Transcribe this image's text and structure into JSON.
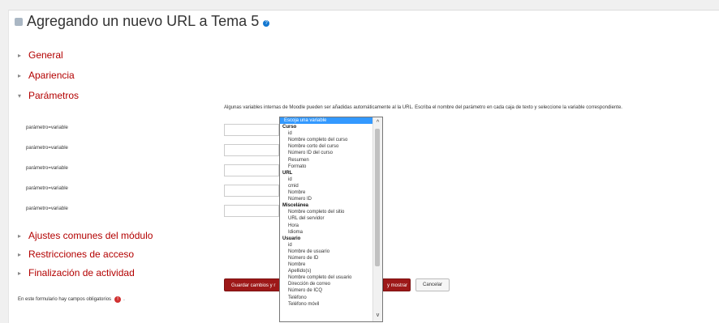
{
  "page": {
    "title": "Agregando un nuevo URL a Tema 5",
    "help_glyph": "?"
  },
  "sections": {
    "general": "General",
    "apariencia": "Apariencia",
    "parametros": "Parámetros",
    "ajustes": "Ajustes comunes del módulo",
    "restricciones": "Restricciones de acceso",
    "finalizacion": "Finalización de actividad"
  },
  "parametros": {
    "intro": "Algunas variables internas de Moodle pueden ser añadidas automáticamente al la URL. Escriba el nombre del parámetro en cada caja de texto y seleccione la variable correspondiente.",
    "rows": [
      {
        "label": "parámetro=variable",
        "value": ""
      },
      {
        "label": "parámetro=variable",
        "value": ""
      },
      {
        "label": "parámetro=variable",
        "value": ""
      },
      {
        "label": "parámetro=variable",
        "value": ""
      },
      {
        "label": "parámetro=variable",
        "value": ""
      }
    ]
  },
  "dropdown": {
    "selected": "Escoja una variable",
    "items": [
      {
        "text": "Escoja una variable",
        "kind": "selected"
      },
      {
        "text": "Curso",
        "kind": "group"
      },
      {
        "text": "id",
        "kind": "child"
      },
      {
        "text": "Nombre completo del curso",
        "kind": "child"
      },
      {
        "text": "Nombre corto del curso",
        "kind": "child"
      },
      {
        "text": "Número ID del curso",
        "kind": "child"
      },
      {
        "text": "Resumen",
        "kind": "child"
      },
      {
        "text": "Formato",
        "kind": "child"
      },
      {
        "text": "URL",
        "kind": "group"
      },
      {
        "text": "id",
        "kind": "child"
      },
      {
        "text": "cmid",
        "kind": "child"
      },
      {
        "text": "Nombre",
        "kind": "child"
      },
      {
        "text": "Número ID",
        "kind": "child"
      },
      {
        "text": "Miscelánea",
        "kind": "group"
      },
      {
        "text": "Nombre completo del sitio",
        "kind": "child"
      },
      {
        "text": "URL del servidor",
        "kind": "child"
      },
      {
        "text": "Hora",
        "kind": "child"
      },
      {
        "text": "Idioma",
        "kind": "child"
      },
      {
        "text": "Usuario",
        "kind": "group"
      },
      {
        "text": "id",
        "kind": "child"
      },
      {
        "text": "Nombre de usuario",
        "kind": "child"
      },
      {
        "text": "Número de ID",
        "kind": "child"
      },
      {
        "text": "Nombre",
        "kind": "child"
      },
      {
        "text": "Apellido(s)",
        "kind": "child"
      },
      {
        "text": "Nombre completo del usuario",
        "kind": "child"
      },
      {
        "text": "Dirección de correo",
        "kind": "child"
      },
      {
        "text": "Número de ICQ",
        "kind": "child"
      },
      {
        "text": "Teléfono",
        "kind": "child"
      },
      {
        "text": "Teléfono móvil",
        "kind": "child"
      }
    ],
    "scroll_up": "^",
    "scroll_down": "v"
  },
  "buttons": {
    "save_return": "Guardar cambios y r",
    "save_show": "y mostrar",
    "cancel": "Cancelar"
  },
  "footer": {
    "required_note": "En este formulario hay campos obligatorios",
    "required_icon": "!",
    "trailing": "."
  },
  "colors": {
    "accent": "#b30000",
    "button_primary": "#9d1818",
    "selection": "#3399ff"
  }
}
